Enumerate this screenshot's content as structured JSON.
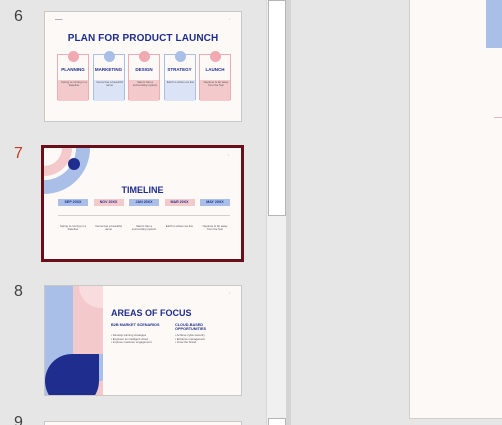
{
  "thumbnails": [
    {
      "number": "6",
      "title": "PLAN FOR PRODUCT LAUNCH",
      "cards": [
        {
          "label": "PLANNING",
          "text": "Spring is coming in a baseline",
          "color": "#f4c9cc",
          "accent": "#f1aab1"
        },
        {
          "label": "MARKETING",
          "text": "Venus has a beautiful name",
          "color": "#dbe3f6",
          "accent": "#a9bfe8"
        },
        {
          "label": "DESIGN",
          "text": "Saturn has a surrounding system",
          "color": "#f4c9cc",
          "accent": "#f1aab1"
        },
        {
          "label": "STRATEGY",
          "text": "Earth is where we live",
          "color": "#dbe3f6",
          "accent": "#a9bfe8"
        },
        {
          "label": "LAUNCH",
          "text": "Neptune is far away from the Sun",
          "color": "#f4c9cc",
          "accent": "#f1aab1"
        }
      ]
    },
    {
      "number": "7",
      "title": "TIMELINE",
      "selected": true,
      "months": [
        {
          "label": "SEP 20XX",
          "color": "#a9bfe8",
          "text": "Spring is coming in a baseline"
        },
        {
          "label": "NOV 20XX",
          "color": "#f4c9cc",
          "text": "Venus has a beautiful name"
        },
        {
          "label": "JAN 20XX",
          "color": "#a9bfe8",
          "text": "Saturn has a surrounding system"
        },
        {
          "label": "MAR 20XX",
          "color": "#f4c9cc",
          "text": "Earth is where we live"
        },
        {
          "label": "MAY 20XX",
          "color": "#a9bfe8",
          "text": "Neptune is far away from the Sun"
        }
      ]
    },
    {
      "number": "8",
      "title": "AREAS OF FOCUS",
      "col1_heading": "B2B MARKET SCENARIOS",
      "col2_heading": "CLOUD-BASED OPPORTUNITIES",
      "col1_items": [
        "Develop winning strategies",
        "Engineer an intelligent cloud",
        "Improve customer engagement"
      ],
      "col2_items": [
        "Achieve cyber-security",
        "Enhance management",
        "Grow the brand"
      ]
    },
    {
      "number": "9"
    }
  ],
  "colors": {
    "navy": "#1f2d8e",
    "pink": "#f4c9cc",
    "blue": "#a9bfe8",
    "selected_border": "#6a0f1a",
    "active_number": "#c43e1c"
  }
}
